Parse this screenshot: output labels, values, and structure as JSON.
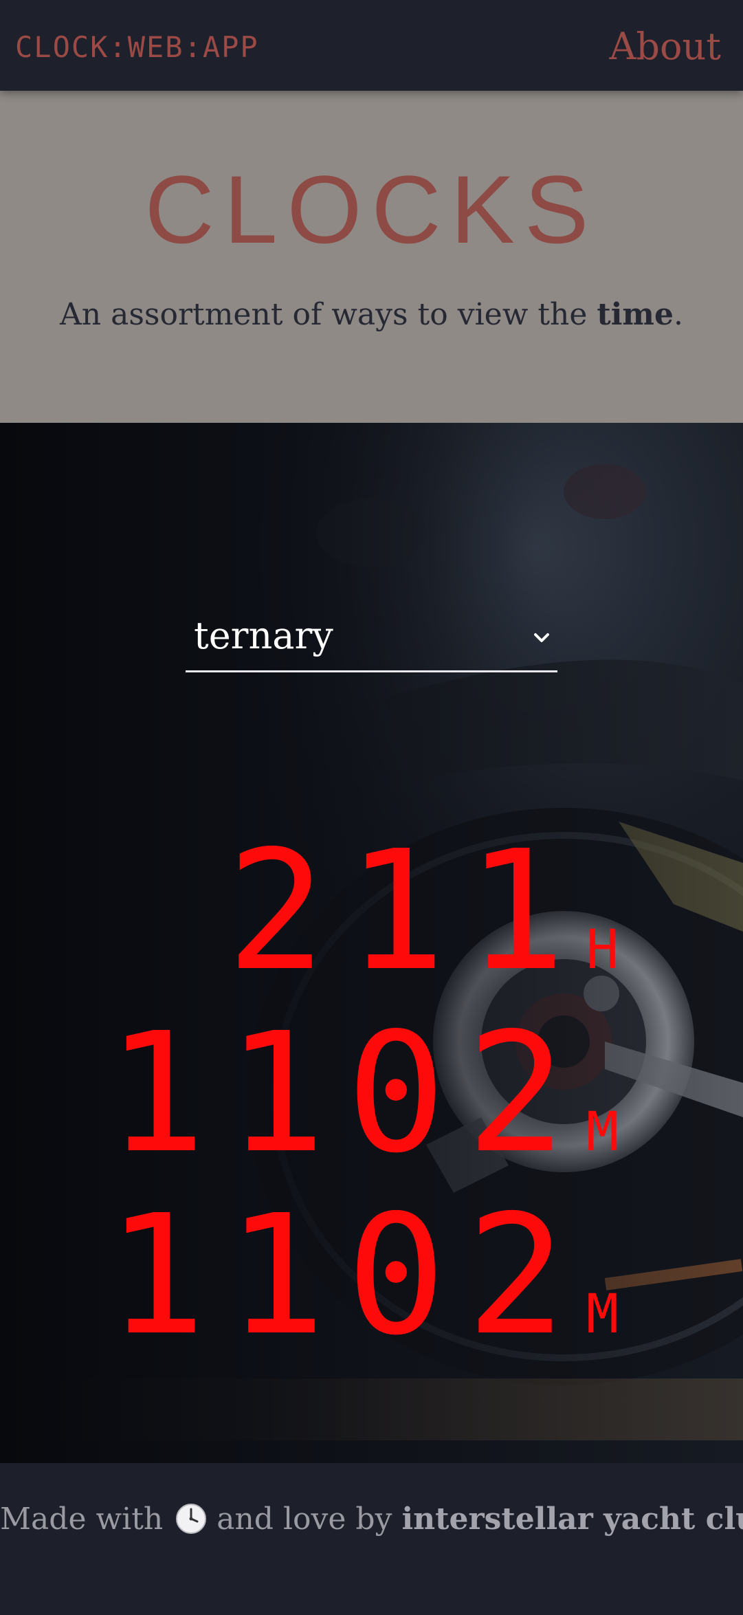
{
  "nav": {
    "brand": "CLOCK:WEB:APP",
    "about": "About"
  },
  "hero": {
    "title": "CLOCKS",
    "subtitle_pre": "An assortment of ways to view the ",
    "subtitle_bold": "time",
    "subtitle_post": "."
  },
  "clock_select": {
    "value": "ternary"
  },
  "clock": {
    "hours": "211",
    "hours_unit": "H",
    "minutes": "1102",
    "minutes_unit": "M",
    "seconds": "1102",
    "seconds_unit": "M"
  },
  "footer": {
    "pre": "Made with",
    "mid": "and love by",
    "author": "interstellar yacht club",
    "emoji_icon": "clock-face-icon"
  },
  "colors": {
    "accent": "#9b4a45",
    "digit": "#ff0a0a",
    "nav_bg": "#1e202b",
    "hero_bg": "#8f8a86"
  }
}
